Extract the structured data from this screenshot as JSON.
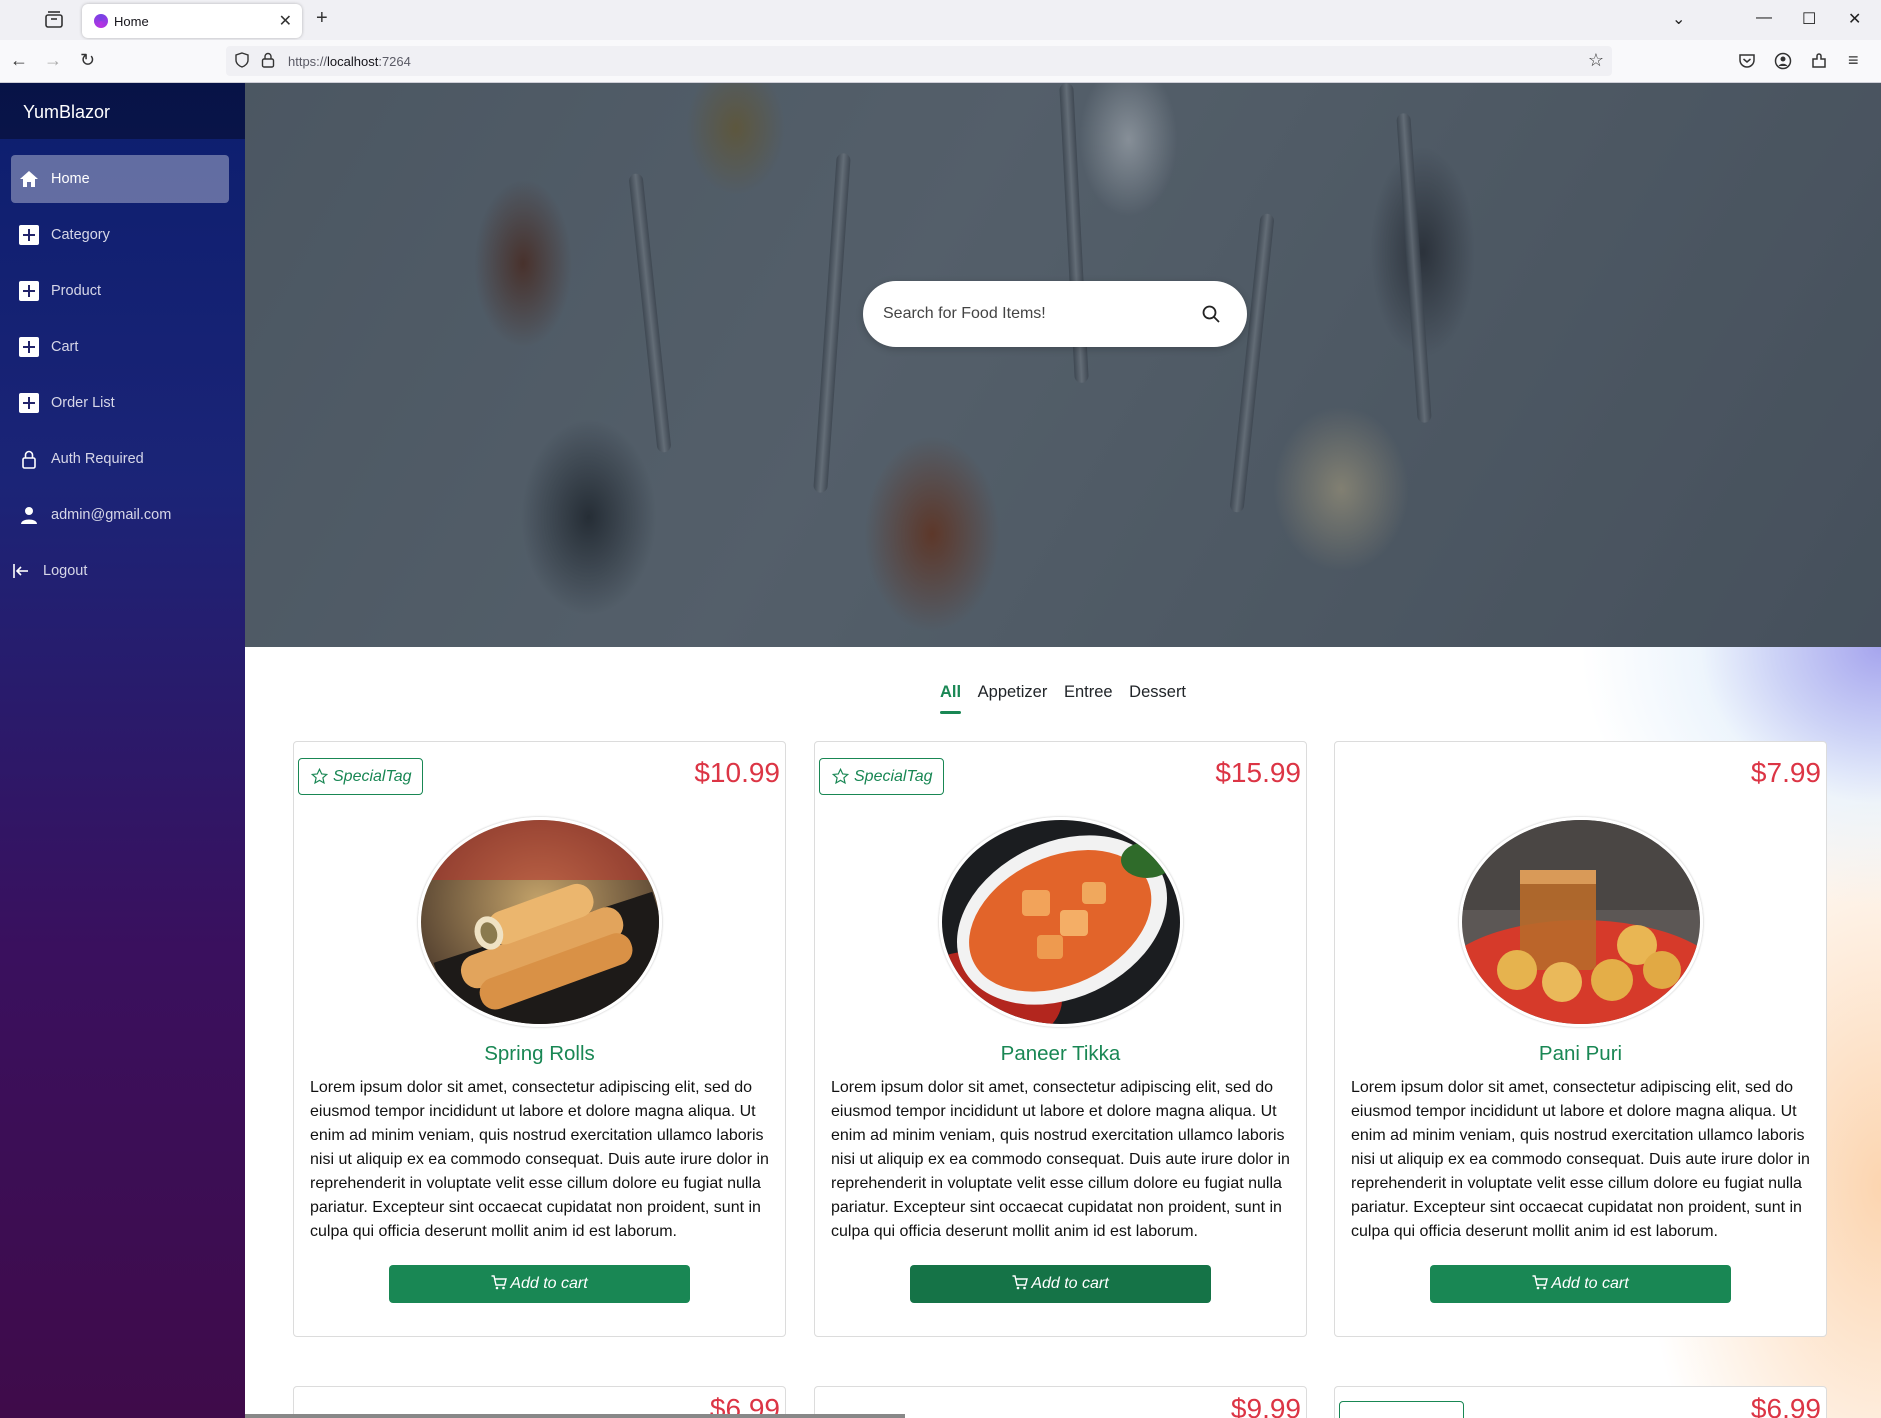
{
  "browser": {
    "tab_title": "Home",
    "url_scheme": "https://",
    "url_host": "localhost",
    "url_port": ":7264"
  },
  "sidebar": {
    "brand": "YumBlazor",
    "items": [
      {
        "label": "Home",
        "icon": "home-icon",
        "active": true
      },
      {
        "label": "Category",
        "icon": "plus-square-icon"
      },
      {
        "label": "Product",
        "icon": "plus-square-icon"
      },
      {
        "label": "Cart",
        "icon": "plus-square-icon"
      },
      {
        "label": "Order List",
        "icon": "plus-square-icon"
      },
      {
        "label": "Auth Required",
        "icon": "lock-icon"
      },
      {
        "label": "admin@gmail.com",
        "icon": "person-icon"
      },
      {
        "label": "Logout",
        "icon": "logout-icon"
      }
    ]
  },
  "hero": {
    "search_placeholder": "Search for Food Items!"
  },
  "filters": {
    "tabs": [
      "All",
      "Appetizer",
      "Entree",
      "Dessert"
    ],
    "active": "All"
  },
  "products": [
    {
      "tag": "SpecialTag",
      "price": "$10.99",
      "name": "Spring Rolls",
      "description": "Lorem ipsum dolor sit amet, consectetur adipiscing elit, sed do eiusmod tempor incididunt ut labore et dolore magna aliqua. Ut enim ad minim veniam, quis nostrud exercitation ullamco laboris nisi ut aliquip ex ea commodo consequat. Duis aute irure dolor in reprehenderit in voluptate velit esse cillum dolore eu fugiat nulla pariatur. Excepteur sint occaecat cupidatat non proident, sunt in culpa qui officia deserunt mollit anim id est laborum.",
      "button": "Add to cart"
    },
    {
      "tag": "SpecialTag",
      "price": "$15.99",
      "name": "Paneer Tikka",
      "description": "Lorem ipsum dolor sit amet, consectetur adipiscing elit, sed do eiusmod tempor incididunt ut labore et dolore magna aliqua. Ut enim ad minim veniam, quis nostrud exercitation ullamco laboris nisi ut aliquip ex ea commodo consequat. Duis aute irure dolor in reprehenderit in voluptate velit esse cillum dolore eu fugiat nulla pariatur. Excepteur sint occaecat cupidatat non proident, sunt in culpa qui officia deserunt mollit anim id est laborum.",
      "button": "Add to cart"
    },
    {
      "tag": "",
      "price": "$7.99",
      "name": "Pani Puri",
      "description": "Lorem ipsum dolor sit amet, consectetur adipiscing elit, sed do eiusmod tempor incididunt ut labore et dolore magna aliqua. Ut enim ad minim veniam, quis nostrud exercitation ullamco laboris nisi ut aliquip ex ea commodo consequat. Duis aute irure dolor in reprehenderit in voluptate velit esse cillum dolore eu fugiat nulla pariatur. Excepteur sint occaecat cupidatat non proident, sunt in culpa qui officia deserunt mollit anim id est laborum.",
      "button": "Add to cart"
    }
  ],
  "next_row_prices": [
    "$6.99",
    "$9.99",
    "$6.99"
  ],
  "colors": {
    "accent_green": "#198754",
    "price_red": "#dc3545"
  }
}
